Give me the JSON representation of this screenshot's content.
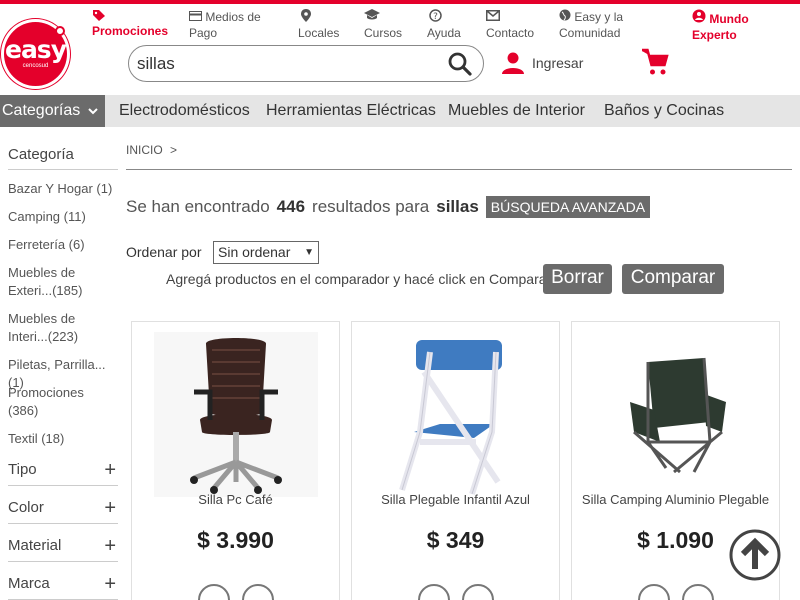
{
  "header": {
    "logo_text": "easy",
    "logo_sub": "cencosud",
    "nav": [
      {
        "label": "Promociones",
        "icon": "tag-icon"
      },
      {
        "label": "Medios de Pago",
        "icon": "card-icon"
      },
      {
        "label": "Locales",
        "icon": "location-pin-icon"
      },
      {
        "label": "Cursos",
        "icon": "graduation-cap-icon"
      },
      {
        "label": "Ayuda",
        "icon": "help-icon"
      },
      {
        "label": "Contacto",
        "icon": "mail-icon"
      },
      {
        "label": "Easy y la Comunidad",
        "icon": "globe-icon"
      },
      {
        "label": "Mundo Experto",
        "icon": "expert-icon"
      }
    ],
    "search_value": "sillas",
    "login_label": "Ingresar"
  },
  "categories_bar": {
    "button_label": "Categorías",
    "links": [
      "Electrodomésticos",
      "Herramientas Eléctricas",
      "Muebles de Interior",
      "Baños y Cocinas"
    ]
  },
  "sidebar": {
    "title": "Categoría",
    "items": [
      "Bazar Y Hogar (1)",
      "Camping (11)",
      "Ferretería (6)",
      "Muebles de Exteri...(185)",
      "Muebles de Interi...(223)",
      "Piletas, Parrilla...(1)",
      "Promociones (386)",
      "Textil (18)"
    ],
    "sections": [
      "Tipo",
      "Color",
      "Material",
      "Marca"
    ]
  },
  "main": {
    "breadcrumb": "INICIO",
    "breadcrumb_sep": ">",
    "results_prefix": "Se han encontrado",
    "results_count": "446",
    "results_mid": "resultados para",
    "results_query": "sillas",
    "advanced_search": "BÚSQUEDA AVANZADA",
    "sort_label": "Ordenar por",
    "sort_value": "Sin ordenar",
    "compare_text": "Agregá productos en el comparador y hacé click en Comparar",
    "clear_button": "Borrar",
    "compare_button": "Comparar"
  },
  "products": [
    {
      "name": "Silla Pc Café",
      "price": "$ 3.990"
    },
    {
      "name": "Silla Plegable Infantil Azul",
      "price": "$ 349"
    },
    {
      "name": "Silla Camping Aluminio Plegable",
      "price": "$ 1.090"
    }
  ],
  "colors": {
    "brand": "#e4002b",
    "gray_button": "#6b6b6b",
    "bar": "#e5e5e5"
  }
}
